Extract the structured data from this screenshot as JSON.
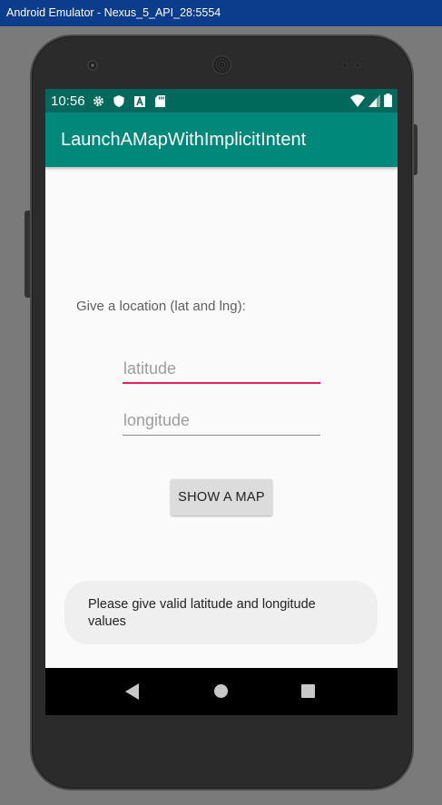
{
  "window": {
    "title": "Android Emulator - Nexus_5_API_28:5554"
  },
  "statusbar": {
    "time": "10:56",
    "icons": [
      "gear-icon",
      "shield-icon",
      "font-a-icon",
      "sd-card-icon",
      "wifi-icon",
      "signal-icon",
      "battery-icon"
    ]
  },
  "app": {
    "title": "LaunchAMapWithImplicitIntent"
  },
  "form": {
    "prompt": "Give a location (lat and lng):",
    "latitude": {
      "value": "",
      "placeholder": "latitude"
    },
    "longitude": {
      "value": "",
      "placeholder": "longitude"
    },
    "button_label": "SHOW A MAP"
  },
  "toast": {
    "message": "Please give valid latitude and longitude values"
  },
  "navbar": {
    "icons": [
      "back-icon",
      "home-icon",
      "recents-icon"
    ]
  },
  "colors": {
    "statusbar": "#00695c",
    "appbar": "#00897b",
    "focus_underline": "#e91e63",
    "window_titlebar": "#0b3d8c"
  }
}
